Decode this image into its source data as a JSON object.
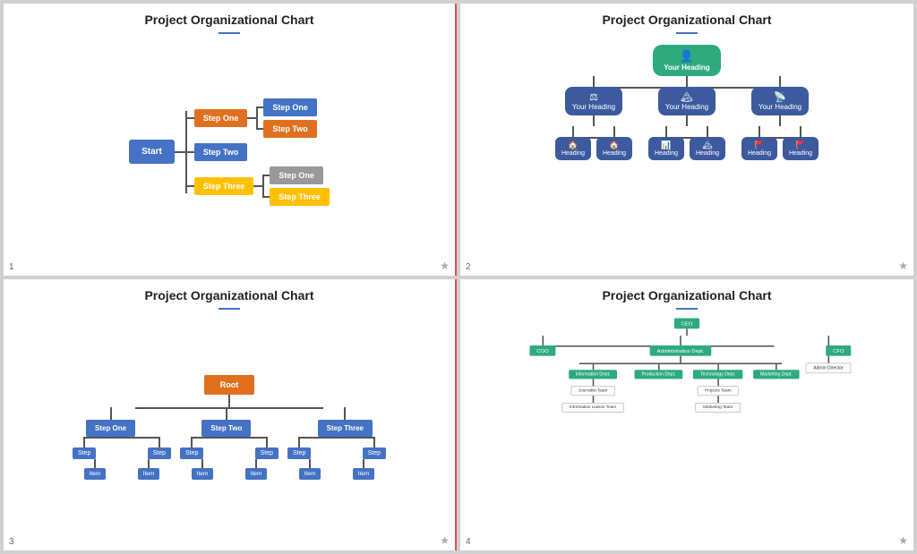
{
  "slides": [
    {
      "id": 1,
      "title": "Project Organizational Chart",
      "number": "1",
      "nodes": {
        "start": "Start",
        "branch1": "Step One",
        "branch2": "Step Two",
        "branch3": "Step Three",
        "sub1a": "Step One",
        "sub1b": "Step Two",
        "sub3a": "Step One",
        "sub3b": "Step Three"
      }
    },
    {
      "id": 2,
      "title": "Project Organizational Chart",
      "number": "2",
      "root": "Your Heading",
      "level2": [
        "Your Heading",
        "Your Heading",
        "Your Heading"
      ],
      "level3": [
        "Heading",
        "Heading",
        "Heading",
        "Heading",
        "Heading",
        "Heading"
      ]
    },
    {
      "id": 3,
      "title": "Project Organizational Chart",
      "number": "3"
    },
    {
      "id": 4,
      "title": "Project Organizational Chart",
      "number": "4",
      "nodes": {
        "ceo": "CEO",
        "coo": "COO",
        "admin": "Administration Dept.",
        "cfo": "CFO",
        "admin_dir": "Admin Director",
        "info": "Information Dept.",
        "prod": "Production Dept.",
        "tech": "Technology Dept.",
        "mkt": "Marketing Dept.",
        "journalist": "Journalist Team",
        "projects": "Projects Team",
        "info_liaison": "Information Liaison Team",
        "marketing_team": "Marketing Team"
      }
    }
  ],
  "star": "★",
  "icons": {
    "person": "👤",
    "balance": "⚖",
    "mountain": "🏔",
    "signal": "📡",
    "flag": "🚩",
    "home": "🏠",
    "chart": "📊"
  }
}
